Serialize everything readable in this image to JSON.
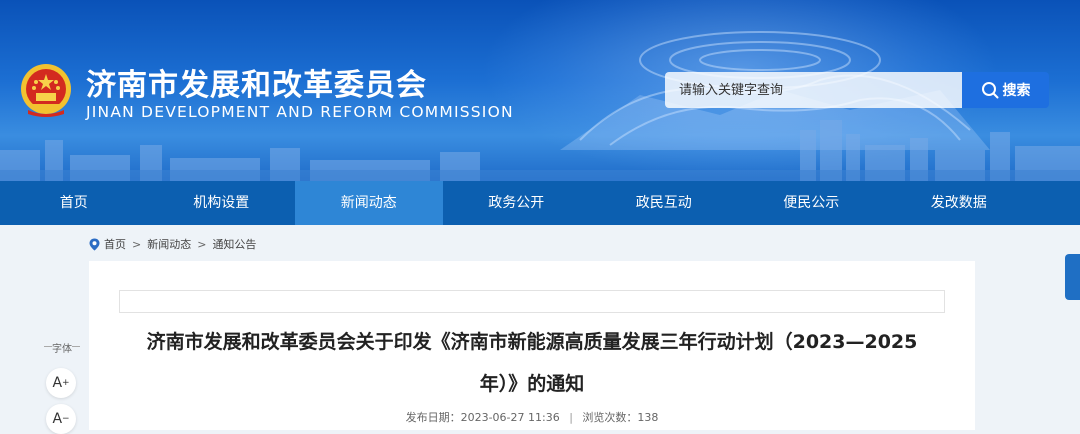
{
  "header": {
    "title": "济南市发展和改革委员会",
    "subtitle": "JINAN DEVELOPMENT AND REFORM COMMISSION",
    "emblem_icon": "national-emblem-icon"
  },
  "search": {
    "placeholder": "请输入关键字查询",
    "button_label": "搜索",
    "icon": "search-icon"
  },
  "nav": {
    "items": [
      {
        "label": "首页"
      },
      {
        "label": "机构设置"
      },
      {
        "label": "新闻动态"
      },
      {
        "label": "政务公开"
      },
      {
        "label": "政民互动"
      },
      {
        "label": "便民公示"
      },
      {
        "label": "发改数据"
      }
    ],
    "active": "新闻动态"
  },
  "breadcrumb": {
    "icon": "location-pin-icon",
    "items": [
      "首页",
      "新闻动态",
      "通知公告"
    ],
    "separator": ">"
  },
  "article": {
    "title": "济南市发展和改革委员会关于印发《济南市新能源高质量发展三年行动计划（2023—2025年）》的通知",
    "date_label": "发布日期：2023-06-27 11:36",
    "views_label": "浏览次数：138"
  },
  "font_tool": {
    "label": "字体",
    "increase_label": "A",
    "increase_mark": "+",
    "decrease_label": "A",
    "decrease_mark": "−"
  },
  "colors": {
    "nav_bg": "#0c5fb0",
    "nav_active": "#2e86d6",
    "search_button": "#1e6fe0",
    "page_bg": "#eef3f8"
  }
}
